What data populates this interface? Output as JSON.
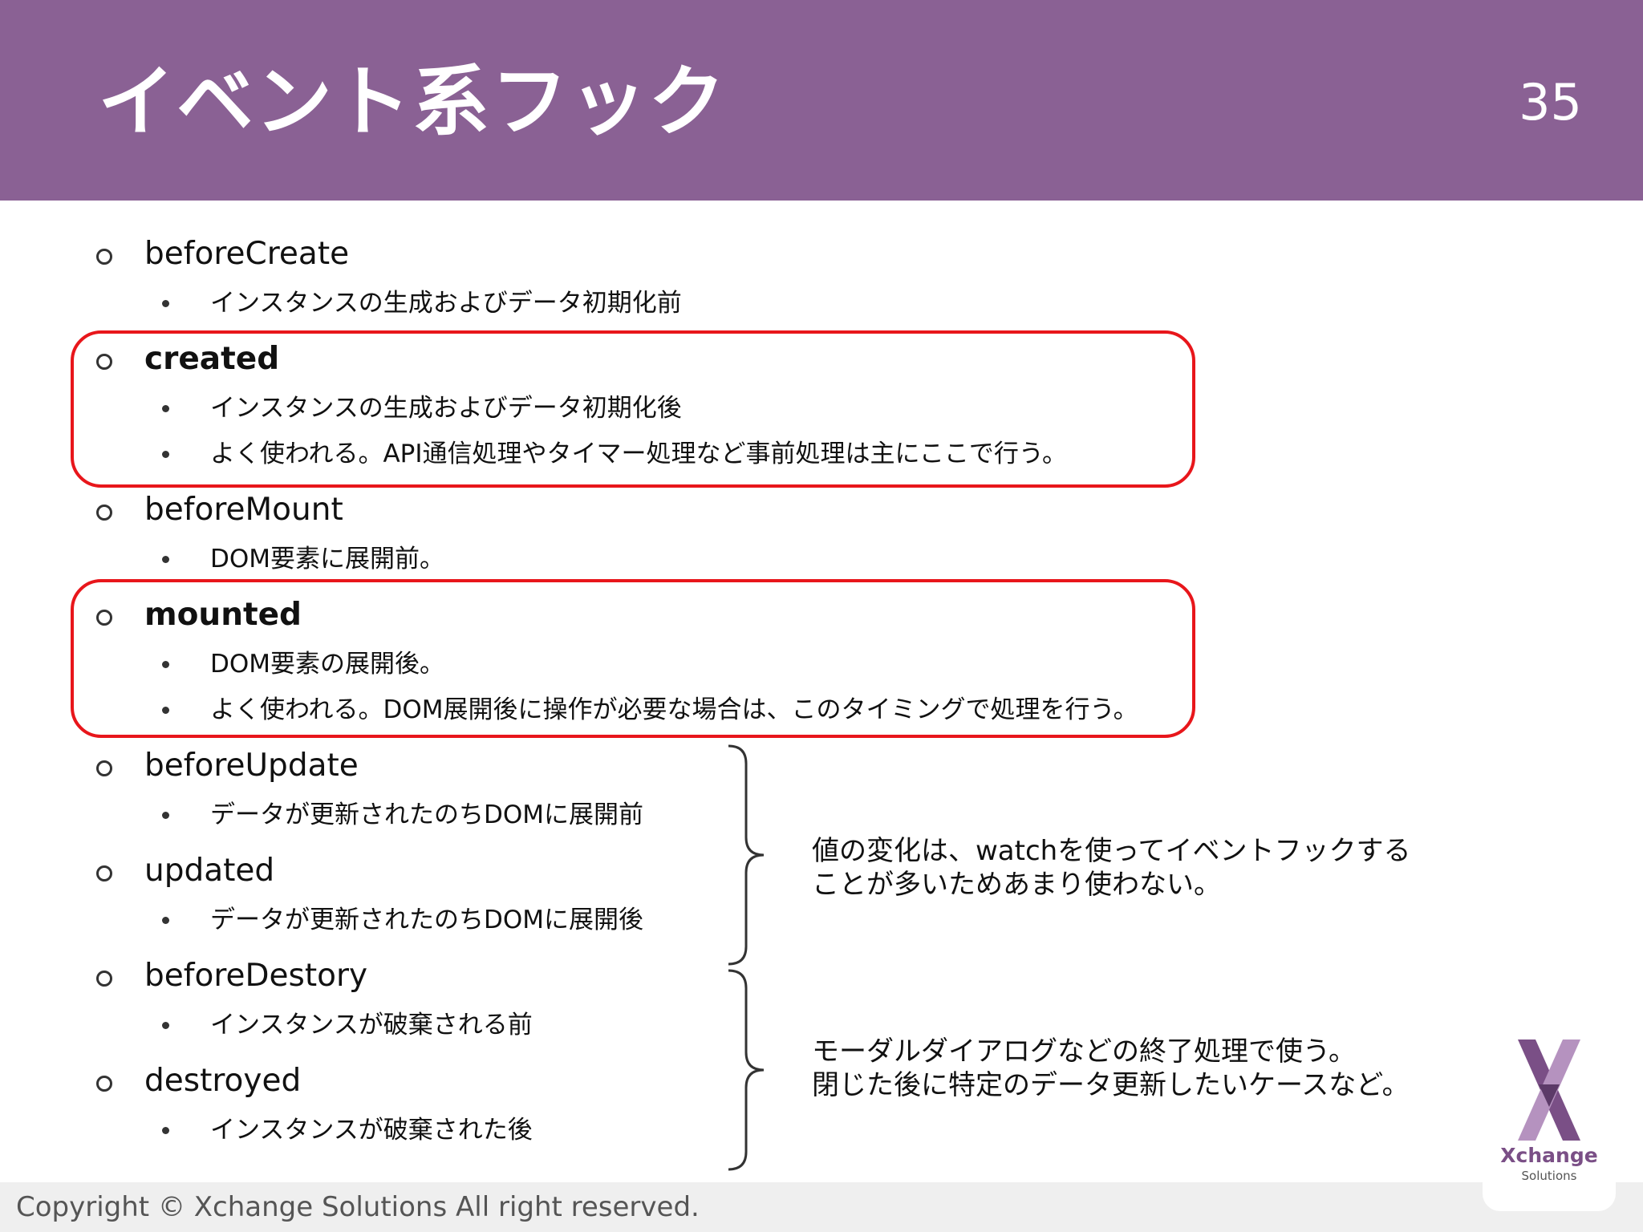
{
  "header": {
    "title": "イベント系フック",
    "page_number": "35"
  },
  "hooks": [
    {
      "name": "beforeCreate",
      "descriptions": [
        "インスタンスの生成およびデータ初期化前"
      ]
    },
    {
      "name": "created",
      "descriptions": [
        "インスタンスの生成およびデータ初期化後",
        "よく使われる。API通信処理やタイマー処理など事前処理は主にここで行う。"
      ]
    },
    {
      "name": "beforeMount",
      "descriptions": [
        "DOM要素に展開前。"
      ]
    },
    {
      "name": "mounted",
      "descriptions": [
        "DOM要素の展開後。",
        "よく使われる。DOM展開後に操作が必要な場合は、このタイミングで処理を行う。"
      ]
    },
    {
      "name": "beforeUpdate",
      "descriptions": [
        "データが更新されたのちDOMに展開前"
      ]
    },
    {
      "name": "updated",
      "descriptions": [
        "データが更新されたのちDOMに展開後"
      ]
    },
    {
      "name": "beforeDestory",
      "descriptions": [
        "インスタンスが破棄される前"
      ]
    },
    {
      "name": "destroyed",
      "descriptions": [
        "インスタンスが破棄された後"
      ]
    }
  ],
  "notes": {
    "update": [
      "値の変化は、watchを使ってイベントフックする",
      "ことが多いためあまり使わない。"
    ],
    "destroy": [
      "モーダルダイアログなどの終了処理で使う。",
      "閉じた後に特定のデータ更新したいケースなど。"
    ]
  },
  "footer": {
    "copyright": "Copyright © Xchange Solutions All right reserved."
  },
  "logo": {
    "name": "Xchange",
    "sub": "Solutions"
  },
  "colors": {
    "header": "#8a6194",
    "highlight": "#e8161b"
  }
}
